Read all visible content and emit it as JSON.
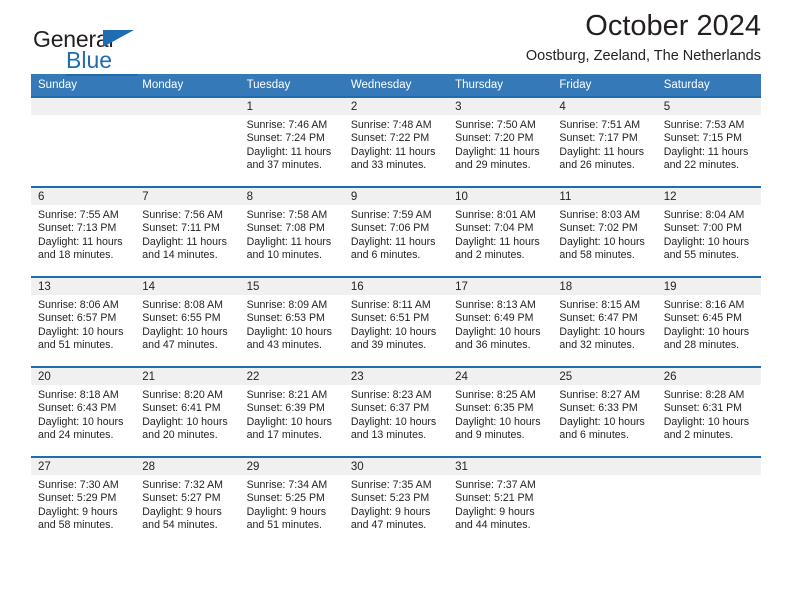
{
  "brand": {
    "name_part1": "General",
    "name_part2": "Blue",
    "accent_color": "#1f6cb0"
  },
  "header": {
    "title": "October 2024",
    "subtitle": "Oostburg, Zeeland, The Netherlands"
  },
  "calendar": {
    "header_bg": "#3579b8",
    "daynum_bg": "#f0f0f0",
    "weekdays": [
      "Sunday",
      "Monday",
      "Tuesday",
      "Wednesday",
      "Thursday",
      "Friday",
      "Saturday"
    ],
    "weeks": [
      [
        {
          "day": "",
          "empty": true,
          "sunrise": "",
          "sunset": "",
          "daylight_line1": "",
          "daylight_line2": ""
        },
        {
          "day": "",
          "empty": true,
          "sunrise": "",
          "sunset": "",
          "daylight_line1": "",
          "daylight_line2": ""
        },
        {
          "day": "1",
          "empty": false,
          "sunrise": "Sunrise: 7:46 AM",
          "sunset": "Sunset: 7:24 PM",
          "daylight_line1": "Daylight: 11 hours",
          "daylight_line2": "and 37 minutes."
        },
        {
          "day": "2",
          "empty": false,
          "sunrise": "Sunrise: 7:48 AM",
          "sunset": "Sunset: 7:22 PM",
          "daylight_line1": "Daylight: 11 hours",
          "daylight_line2": "and 33 minutes."
        },
        {
          "day": "3",
          "empty": false,
          "sunrise": "Sunrise: 7:50 AM",
          "sunset": "Sunset: 7:20 PM",
          "daylight_line1": "Daylight: 11 hours",
          "daylight_line2": "and 29 minutes."
        },
        {
          "day": "4",
          "empty": false,
          "sunrise": "Sunrise: 7:51 AM",
          "sunset": "Sunset: 7:17 PM",
          "daylight_line1": "Daylight: 11 hours",
          "daylight_line2": "and 26 minutes."
        },
        {
          "day": "5",
          "empty": false,
          "sunrise": "Sunrise: 7:53 AM",
          "sunset": "Sunset: 7:15 PM",
          "daylight_line1": "Daylight: 11 hours",
          "daylight_line2": "and 22 minutes."
        }
      ],
      [
        {
          "day": "6",
          "empty": false,
          "sunrise": "Sunrise: 7:55 AM",
          "sunset": "Sunset: 7:13 PM",
          "daylight_line1": "Daylight: 11 hours",
          "daylight_line2": "and 18 minutes."
        },
        {
          "day": "7",
          "empty": false,
          "sunrise": "Sunrise: 7:56 AM",
          "sunset": "Sunset: 7:11 PM",
          "daylight_line1": "Daylight: 11 hours",
          "daylight_line2": "and 14 minutes."
        },
        {
          "day": "8",
          "empty": false,
          "sunrise": "Sunrise: 7:58 AM",
          "sunset": "Sunset: 7:08 PM",
          "daylight_line1": "Daylight: 11 hours",
          "daylight_line2": "and 10 minutes."
        },
        {
          "day": "9",
          "empty": false,
          "sunrise": "Sunrise: 7:59 AM",
          "sunset": "Sunset: 7:06 PM",
          "daylight_line1": "Daylight: 11 hours",
          "daylight_line2": "and 6 minutes."
        },
        {
          "day": "10",
          "empty": false,
          "sunrise": "Sunrise: 8:01 AM",
          "sunset": "Sunset: 7:04 PM",
          "daylight_line1": "Daylight: 11 hours",
          "daylight_line2": "and 2 minutes."
        },
        {
          "day": "11",
          "empty": false,
          "sunrise": "Sunrise: 8:03 AM",
          "sunset": "Sunset: 7:02 PM",
          "daylight_line1": "Daylight: 10 hours",
          "daylight_line2": "and 58 minutes."
        },
        {
          "day": "12",
          "empty": false,
          "sunrise": "Sunrise: 8:04 AM",
          "sunset": "Sunset: 7:00 PM",
          "daylight_line1": "Daylight: 10 hours",
          "daylight_line2": "and 55 minutes."
        }
      ],
      [
        {
          "day": "13",
          "empty": false,
          "sunrise": "Sunrise: 8:06 AM",
          "sunset": "Sunset: 6:57 PM",
          "daylight_line1": "Daylight: 10 hours",
          "daylight_line2": "and 51 minutes."
        },
        {
          "day": "14",
          "empty": false,
          "sunrise": "Sunrise: 8:08 AM",
          "sunset": "Sunset: 6:55 PM",
          "daylight_line1": "Daylight: 10 hours",
          "daylight_line2": "and 47 minutes."
        },
        {
          "day": "15",
          "empty": false,
          "sunrise": "Sunrise: 8:09 AM",
          "sunset": "Sunset: 6:53 PM",
          "daylight_line1": "Daylight: 10 hours",
          "daylight_line2": "and 43 minutes."
        },
        {
          "day": "16",
          "empty": false,
          "sunrise": "Sunrise: 8:11 AM",
          "sunset": "Sunset: 6:51 PM",
          "daylight_line1": "Daylight: 10 hours",
          "daylight_line2": "and 39 minutes."
        },
        {
          "day": "17",
          "empty": false,
          "sunrise": "Sunrise: 8:13 AM",
          "sunset": "Sunset: 6:49 PM",
          "daylight_line1": "Daylight: 10 hours",
          "daylight_line2": "and 36 minutes."
        },
        {
          "day": "18",
          "empty": false,
          "sunrise": "Sunrise: 8:15 AM",
          "sunset": "Sunset: 6:47 PM",
          "daylight_line1": "Daylight: 10 hours",
          "daylight_line2": "and 32 minutes."
        },
        {
          "day": "19",
          "empty": false,
          "sunrise": "Sunrise: 8:16 AM",
          "sunset": "Sunset: 6:45 PM",
          "daylight_line1": "Daylight: 10 hours",
          "daylight_line2": "and 28 minutes."
        }
      ],
      [
        {
          "day": "20",
          "empty": false,
          "sunrise": "Sunrise: 8:18 AM",
          "sunset": "Sunset: 6:43 PM",
          "daylight_line1": "Daylight: 10 hours",
          "daylight_line2": "and 24 minutes."
        },
        {
          "day": "21",
          "empty": false,
          "sunrise": "Sunrise: 8:20 AM",
          "sunset": "Sunset: 6:41 PM",
          "daylight_line1": "Daylight: 10 hours",
          "daylight_line2": "and 20 minutes."
        },
        {
          "day": "22",
          "empty": false,
          "sunrise": "Sunrise: 8:21 AM",
          "sunset": "Sunset: 6:39 PM",
          "daylight_line1": "Daylight: 10 hours",
          "daylight_line2": "and 17 minutes."
        },
        {
          "day": "23",
          "empty": false,
          "sunrise": "Sunrise: 8:23 AM",
          "sunset": "Sunset: 6:37 PM",
          "daylight_line1": "Daylight: 10 hours",
          "daylight_line2": "and 13 minutes."
        },
        {
          "day": "24",
          "empty": false,
          "sunrise": "Sunrise: 8:25 AM",
          "sunset": "Sunset: 6:35 PM",
          "daylight_line1": "Daylight: 10 hours",
          "daylight_line2": "and 9 minutes."
        },
        {
          "day": "25",
          "empty": false,
          "sunrise": "Sunrise: 8:27 AM",
          "sunset": "Sunset: 6:33 PM",
          "daylight_line1": "Daylight: 10 hours",
          "daylight_line2": "and 6 minutes."
        },
        {
          "day": "26",
          "empty": false,
          "sunrise": "Sunrise: 8:28 AM",
          "sunset": "Sunset: 6:31 PM",
          "daylight_line1": "Daylight: 10 hours",
          "daylight_line2": "and 2 minutes."
        }
      ],
      [
        {
          "day": "27",
          "empty": false,
          "sunrise": "Sunrise: 7:30 AM",
          "sunset": "Sunset: 5:29 PM",
          "daylight_line1": "Daylight: 9 hours",
          "daylight_line2": "and 58 minutes."
        },
        {
          "day": "28",
          "empty": false,
          "sunrise": "Sunrise: 7:32 AM",
          "sunset": "Sunset: 5:27 PM",
          "daylight_line1": "Daylight: 9 hours",
          "daylight_line2": "and 54 minutes."
        },
        {
          "day": "29",
          "empty": false,
          "sunrise": "Sunrise: 7:34 AM",
          "sunset": "Sunset: 5:25 PM",
          "daylight_line1": "Daylight: 9 hours",
          "daylight_line2": "and 51 minutes."
        },
        {
          "day": "30",
          "empty": false,
          "sunrise": "Sunrise: 7:35 AM",
          "sunset": "Sunset: 5:23 PM",
          "daylight_line1": "Daylight: 9 hours",
          "daylight_line2": "and 47 minutes."
        },
        {
          "day": "31",
          "empty": false,
          "sunrise": "Sunrise: 7:37 AM",
          "sunset": "Sunset: 5:21 PM",
          "daylight_line1": "Daylight: 9 hours",
          "daylight_line2": "and 44 minutes."
        },
        {
          "day": "",
          "empty": true,
          "sunrise": "",
          "sunset": "",
          "daylight_line1": "",
          "daylight_line2": ""
        },
        {
          "day": "",
          "empty": true,
          "sunrise": "",
          "sunset": "",
          "daylight_line1": "",
          "daylight_line2": ""
        }
      ]
    ]
  }
}
